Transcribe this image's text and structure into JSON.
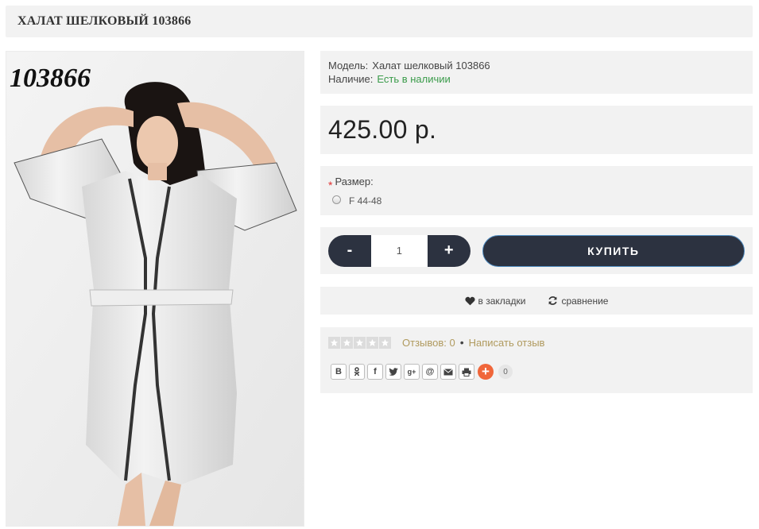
{
  "page_title": "ХАЛАТ ШЕЛКОВЫЙ 103866",
  "photo": {
    "overlay_text": "103866"
  },
  "info": {
    "model_label": "Модель:",
    "model_value": "Халат шелковый 103866",
    "stock_label": "Наличие:",
    "stock_value": "Есть в наличии"
  },
  "price": "425.00 р.",
  "options": {
    "required_mark": "*",
    "size_label": "Размер:",
    "size_option": "F 44-48"
  },
  "cart": {
    "minus_label": "-",
    "quantity": "1",
    "plus_label": "+",
    "buy_label": "КУПИТЬ"
  },
  "actions": {
    "bookmark_label": "в закладки",
    "compare_label": "сравнение"
  },
  "reviews": {
    "rating_stars": 0,
    "rating_max": 5,
    "reviews_label": "Отзывов: 0",
    "separator": "•",
    "write_label": "Написать отзыв"
  },
  "share": {
    "buttons": [
      "В",
      "ok",
      "f",
      "twitter",
      "g+",
      "@",
      "mail",
      "print"
    ],
    "plus_label": "+",
    "count": "0"
  },
  "colors": {
    "dark_button": "#2c3240",
    "in_stock": "#3a9b4a",
    "link_gold": "#b09a5e",
    "share_plus": "#f0663a",
    "block_bg": "#f2f2f2"
  }
}
